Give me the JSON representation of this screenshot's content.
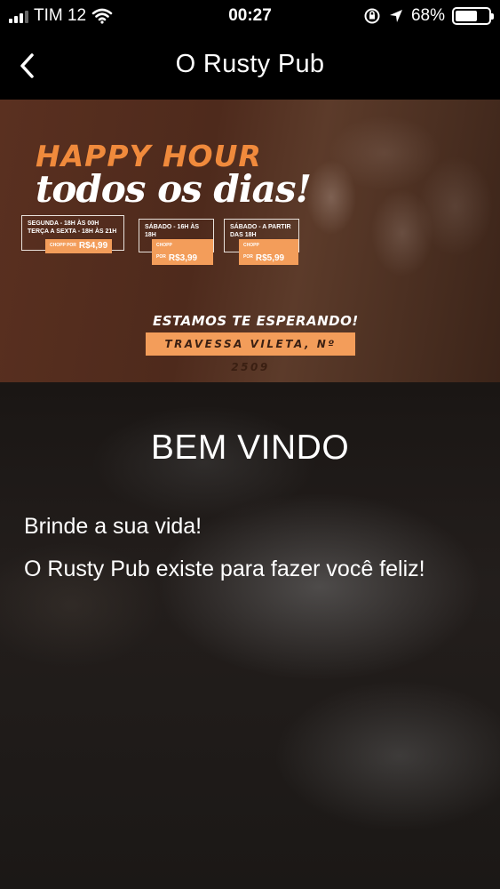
{
  "status_bar": {
    "carrier": "TIM 12",
    "time": "00:27",
    "battery_percent": "68%",
    "battery_level": 0.68,
    "icons": [
      "signal-icon",
      "wifi-icon",
      "orientation-lock-icon",
      "location-arrow-icon",
      "battery-icon"
    ]
  },
  "nav": {
    "title": "O Rusty Pub",
    "back_icon": "chevron-left-icon"
  },
  "banner": {
    "headline": "HAPPY HOUR",
    "script_line": "todos os dias!",
    "promos": [
      {
        "schedule_1": "SEGUNDA - 18H ÀS 00H",
        "schedule_2": "TERÇA A SEXTA - 18H ÀS 21H",
        "price_label": "CHOPP POR",
        "price": "R$4,99"
      },
      {
        "schedule_1": "SÁBADO - 16H ÀS 18H",
        "price_label": "CHOPP POR",
        "price": "R$3,99"
      },
      {
        "schedule_1": "SÁBADO - A PARTIR DAS 18H",
        "price_label": "CHOPP POR",
        "price": "R$5,99"
      }
    ],
    "waiting": "ESTAMOS TE ESPERANDO!",
    "address": "TRAVESSA VILETA, Nº 2509",
    "colors": {
      "accent": "#f39d5a",
      "title_orange": "#f08a3c",
      "background": "#4e2a1c"
    }
  },
  "main": {
    "heading": "BEM VINDO",
    "line_1": "Brinde a sua vida!",
    "line_2": "O Rusty Pub existe para fazer você feliz!"
  }
}
